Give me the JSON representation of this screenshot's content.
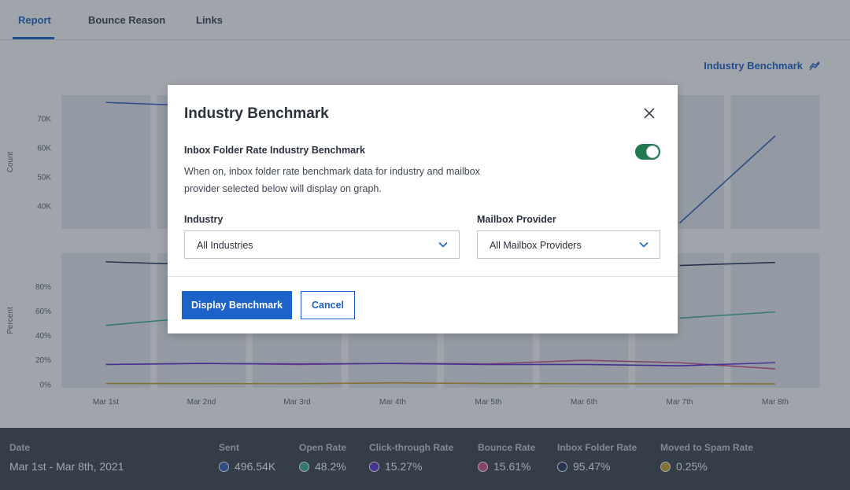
{
  "tabs": [
    {
      "label": "Report",
      "active": true
    },
    {
      "label": "Bounce Reason",
      "active": false
    },
    {
      "label": "Links",
      "active": false
    }
  ],
  "benchmark_link": {
    "label": "Industry Benchmark",
    "icon": "trend-lines-icon"
  },
  "chart_data": [
    {
      "type": "line",
      "ylabel": "Count",
      "y_ticks": [
        "70K",
        "60K",
        "50K",
        "40K"
      ],
      "y_tick_values": [
        70000,
        60000,
        50000,
        40000
      ],
      "ylim": [
        32000,
        78000
      ],
      "categories": [
        "Mar 1st",
        "Mar 2nd",
        "Mar 3rd",
        "Mar 4th",
        "Mar 5th",
        "Mar 6th",
        "Mar 7th",
        "Mar 8th"
      ],
      "series": [
        {
          "color": "#2f5fbf",
          "values": [
            75500,
            74300,
            null,
            null,
            null,
            null,
            34000,
            64000
          ]
        }
      ]
    },
    {
      "type": "line",
      "ylabel": "Percent",
      "y_ticks": [
        "80%",
        "60%",
        "40%",
        "20%",
        "0%"
      ],
      "y_tick_values": [
        80,
        60,
        40,
        20,
        0
      ],
      "ylim": [
        -3,
        107
      ],
      "categories": [
        "Mar 1st",
        "Mar 2nd",
        "Mar 3rd",
        "Mar 4th",
        "Mar 5th",
        "Mar 6th",
        "Mar 7th",
        "Mar 8th"
      ],
      "series": [
        {
          "color": "#23325a",
          "values": [
            100,
            97.5,
            null,
            null,
            null,
            null,
            97,
            99.5
          ]
        },
        {
          "color": "#3bae9d",
          "values": [
            48,
            55,
            null,
            null,
            null,
            null,
            54,
            59
          ]
        },
        {
          "color": "#d04f8a",
          "values": [
            16,
            17,
            16,
            17,
            16.5,
            19.5,
            17.5,
            12.5
          ]
        },
        {
          "color": "#5b2fd0",
          "values": [
            16,
            16.8,
            16.5,
            16.8,
            16,
            16,
            15,
            17.5
          ]
        },
        {
          "color": "#c9a227",
          "values": [
            0.5,
            0.4,
            0.3,
            1,
            0.5,
            0.3,
            0.3,
            0.2
          ]
        }
      ]
    }
  ],
  "stats": [
    {
      "label": "Date",
      "value": "Mar 1st - Mar 8th, 2021",
      "color": null
    },
    {
      "label": "Sent",
      "value": "496.54K",
      "color": "#2f5fbf"
    },
    {
      "label": "Open Rate",
      "value": "48.2%",
      "color": "#3bae9d"
    },
    {
      "label": "Click-through Rate",
      "value": "15.27%",
      "color": "#5b2fd0"
    },
    {
      "label": "Bounce Rate",
      "value": "15.61%",
      "color": "#d04f8a"
    },
    {
      "label": "Inbox Folder Rate",
      "value": "95.47%",
      "color": "#23325a"
    },
    {
      "label": "Moved to Spam Rate",
      "value": "0.25%",
      "color": "#c9a227"
    }
  ],
  "modal": {
    "title": "Industry Benchmark",
    "toggle_label": "Inbox Folder Rate Industry Benchmark",
    "toggle_on": true,
    "toggle_description": "When on, inbox folder rate benchmark data for industry and mailbox provider selected below will display on graph.",
    "industry_label": "Industry",
    "industry_value": "All Industries",
    "provider_label": "Mailbox Provider",
    "provider_value": "All Mailbox Providers",
    "primary_button": "Display Benchmark",
    "cancel_button": "Cancel"
  },
  "colors": {
    "accent": "#1c62c8",
    "toggle_on": "#217a4f",
    "stats_bg": "#3b424c"
  }
}
